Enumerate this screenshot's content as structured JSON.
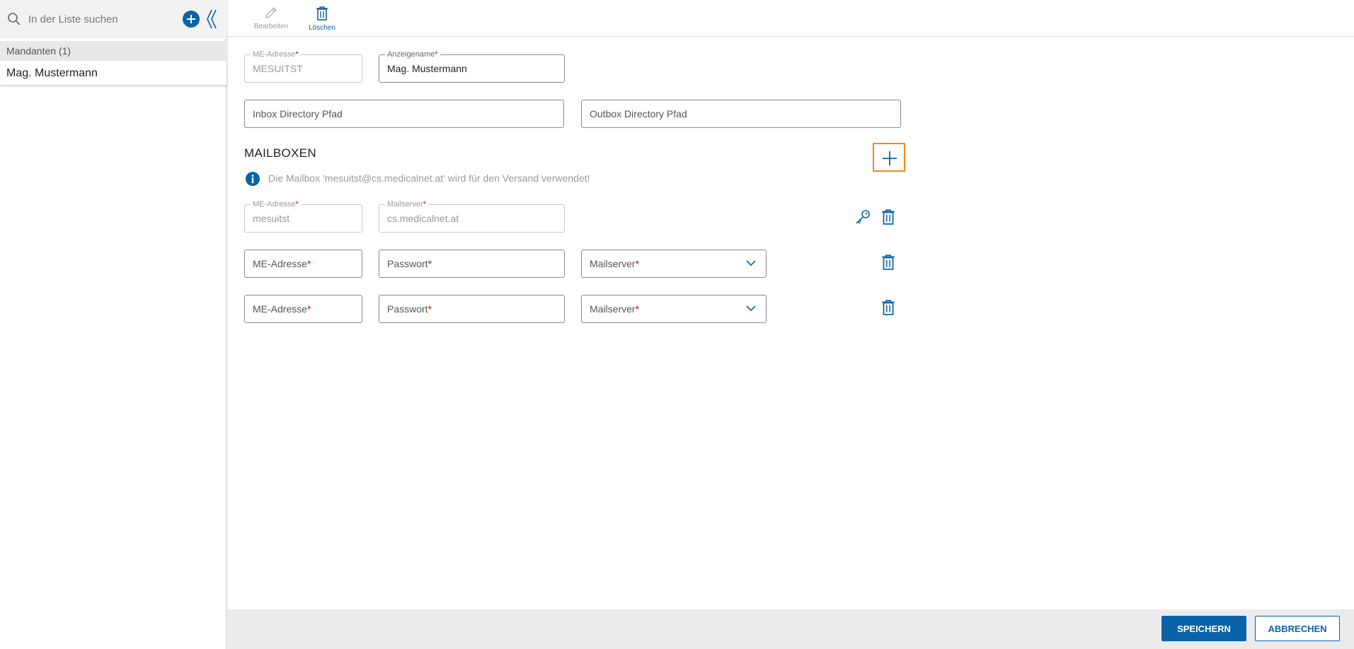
{
  "sidebar": {
    "search_placeholder": "In der Liste suchen",
    "group_header": "Mandanten (1)",
    "items": [
      {
        "label": "Mag. Mustermann"
      }
    ]
  },
  "toolbar": {
    "edit_label": "Bearbeiten",
    "delete_label": "Löschen"
  },
  "form": {
    "me_address": {
      "label": "ME-Adresse",
      "value": "MESUITST"
    },
    "display_name": {
      "label": "Anzeigename",
      "value": "Mag. Mustermann"
    },
    "inbox_path": {
      "placeholder": "Inbox Directory Pfad"
    },
    "outbox_path": {
      "placeholder": "Outbox Directory Pfad"
    }
  },
  "mailboxes": {
    "title": "MAILBOXEN",
    "info": "Die Mailbox 'mesuitst@cs.medicalnet.at' wird für den Versand verwendet!",
    "existing": {
      "me_label": "ME-Adresse",
      "me_value": "mesuitst",
      "server_label": "Mailserver",
      "server_value": "cs.medicalnet.at"
    },
    "new_rows": [
      {
        "me_placeholder": "ME-Adresse",
        "password_placeholder": "Passwort",
        "server_placeholder": "Mailserver"
      },
      {
        "me_placeholder": "ME-Adresse",
        "password_placeholder": "Passwort",
        "server_placeholder": "Mailserver"
      }
    ]
  },
  "footer": {
    "save_label": "SPEICHERN",
    "cancel_label": "ABBRECHEN"
  },
  "colors": {
    "accent": "#0a63a8",
    "highlight": "#f28a1a",
    "required": "#d0021b"
  }
}
